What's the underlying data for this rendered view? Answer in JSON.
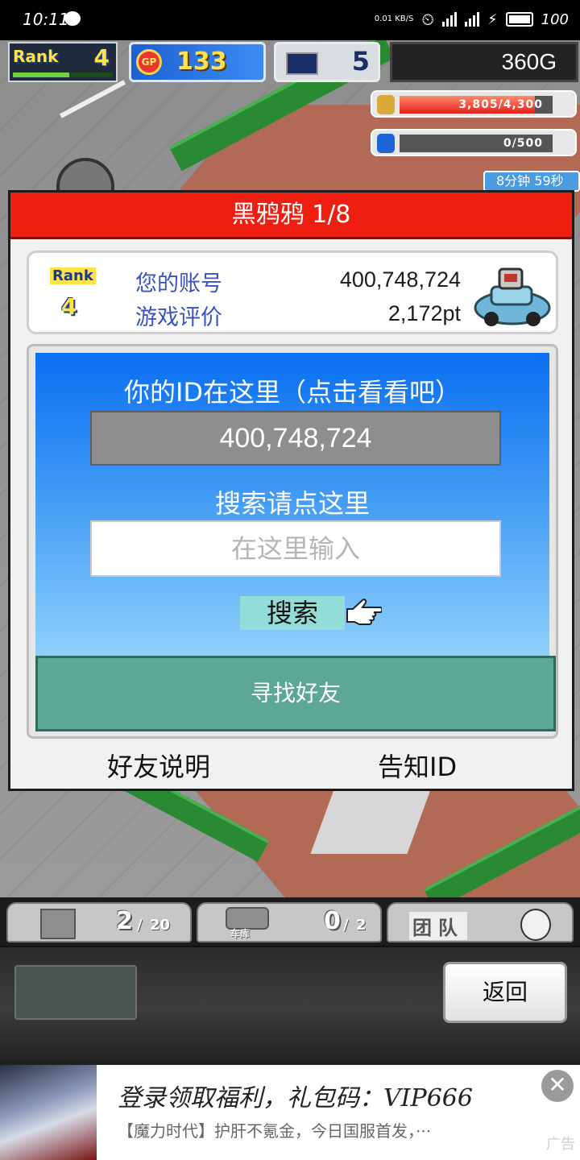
{
  "status_bar": {
    "time": "10:11",
    "net_speed": "0.01 KB/S",
    "battery": "100"
  },
  "hud": {
    "rank_label": "Rank",
    "rank_value": "4",
    "gp_label": "GP",
    "gp_value": "133",
    "pc_value": "5",
    "money": "360G",
    "resource1": "3,805/4,300",
    "resource1_fill": 0.885,
    "resource2": "0/500",
    "resource2_fill": 0.0,
    "timer": "8分钟 59秒"
  },
  "dialog": {
    "title": "黑鸦鸦 1/8",
    "profile": {
      "rank_label": "Rank",
      "rank_value": "4",
      "account_label": "您的账号",
      "account_value": "400,748,724",
      "rating_label": "游戏评价",
      "rating_value": "2,172pt"
    },
    "id_caption": "你的ID在这里（点击看看吧）",
    "id_value": "400,748,724",
    "search_caption": "搜索请点这里",
    "search_placeholder": "在这里输入",
    "search_button": "搜索",
    "find_friends": "寻找好友",
    "friend_help": "好友说明",
    "notify_id": "告知ID"
  },
  "bottom_tabs": {
    "crate_count": "2",
    "crate_max": "20",
    "garage_label": "车库",
    "garage_count": "0",
    "garage_max": "2",
    "team_label": "团队"
  },
  "back_button": "返回",
  "ad": {
    "line1": "登录领取福利，礼包码：VIP666",
    "line2": "【魔力时代】护肝不氪金，今日国服首发，···",
    "tag": "广告",
    "close": "✕"
  },
  "colors": {
    "title_red": "#ee1f10",
    "panel_blue": "#0a6ff2",
    "friend_green": "#5ca893"
  }
}
